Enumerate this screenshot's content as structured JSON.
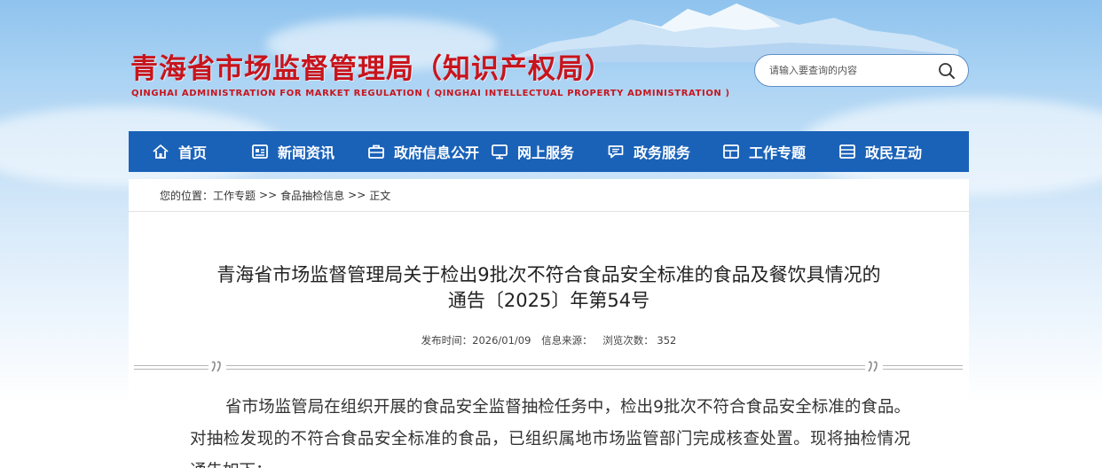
{
  "header": {
    "title": "青海省市场监督管理局（知识产权局）",
    "subtitle": "QINGHAI ADMINISTRATION FOR MARKET REGULATION ( QINGHAI INTELLECTUAL PROPERTY ADMINISTRATION )"
  },
  "search": {
    "placeholder": "请输入要查询的内容",
    "icon": "search-icon"
  },
  "nav": {
    "items": [
      {
        "label": "首页",
        "icon": "home-icon"
      },
      {
        "label": "新闻资讯",
        "icon": "news-icon"
      },
      {
        "label": "政府信息公开",
        "icon": "briefcase-icon"
      },
      {
        "label": "网上服务",
        "icon": "monitor-icon"
      },
      {
        "label": "政务服务",
        "icon": "chat-icon"
      },
      {
        "label": "工作专题",
        "icon": "layout-icon"
      },
      {
        "label": "政民互动",
        "icon": "window-icon"
      }
    ],
    "color": "#1a62b8"
  },
  "breadcrumb": {
    "prefix": "您的位置：",
    "items": [
      "工作专题",
      "食品抽检信息",
      "正文"
    ],
    "separator": ">>"
  },
  "article": {
    "title_line1": "青海省市场监督管理局关于检出9批次不符合食品安全标准的食品及餐饮具情况的",
    "title_line2": "通告〔2025〕年第54号",
    "meta": {
      "date_label": "发布时间：",
      "date": "2026/01/09",
      "source_label": "信息来源：",
      "views_label": "浏览次数：",
      "views": "352"
    },
    "body": "省市场监管局在组织开展的食品安全监督抽检任务中，检出9批次不符合食品安全标准的食品。对抽检发现的不符合食品安全标准的食品，已组织属地市场监管部门完成核查处置。现将抽检情况通告如下："
  },
  "colors": {
    "title_red": "#c8141c",
    "nav_blue": "#1a62b8"
  }
}
